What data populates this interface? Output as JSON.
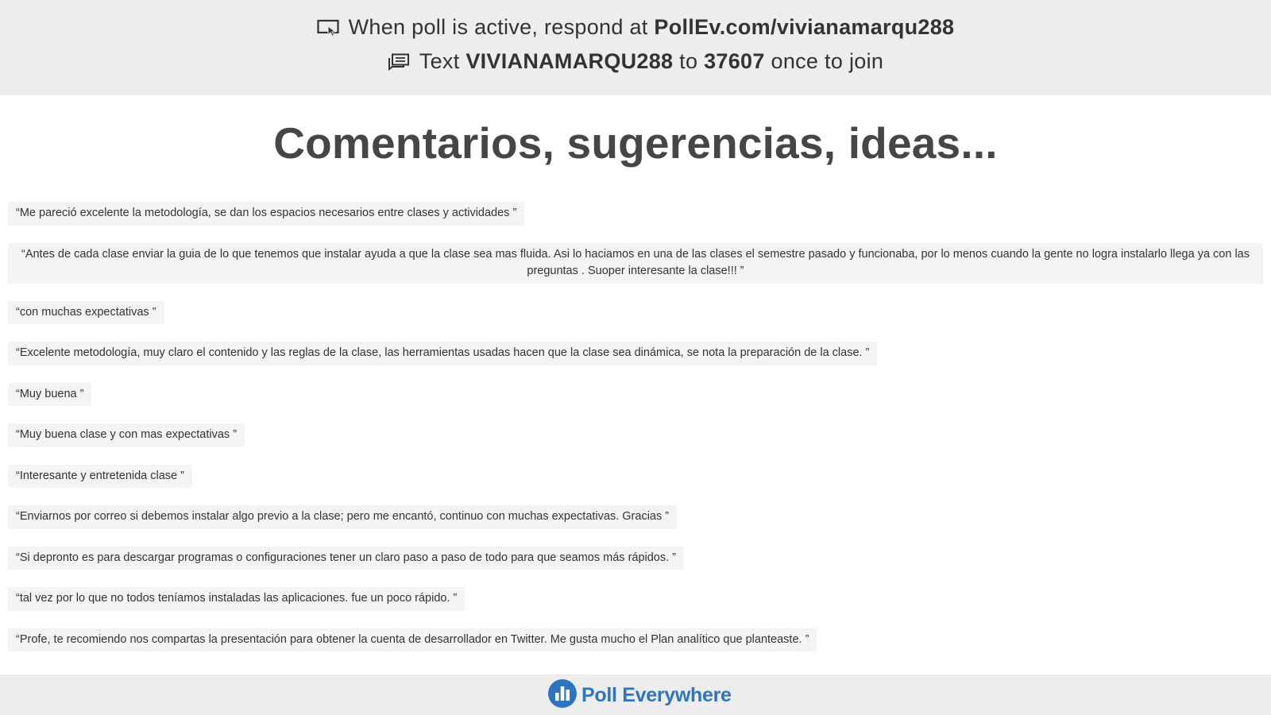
{
  "header": {
    "line1_icon": "presentation-screen-icon",
    "line1_prefix": "When poll is active, respond at ",
    "line1_url": "PollEv.com/vivianamarqu288",
    "line2_icon": "text-message-icon",
    "line2_prefix": "Text ",
    "line2_code": "VIVIANAMARQU288",
    "line2_mid": " to ",
    "line2_number": "37607",
    "line2_suffix": " once to join"
  },
  "poll": {
    "title": "Comentarios, sugerencias, ideas..."
  },
  "responses": [
    "“Me pareció excelente la metodología, se dan los espacios necesarios entre clases y actividades ”",
    "“Antes de cada clase enviar la guia de lo que tenemos que instalar ayuda a que la clase sea mas fluida. Asi lo haciamos en una de las clases el semestre pasado y funcionaba, por lo menos cuando la gente no logra instalarlo llega ya con las preguntas . Suoper interesante la clase!!! ”",
    "“con muchas expectativas ”",
    "“Excelente metodología, muy claro el contenido y las reglas de la clase, las herramientas usadas hacen que la clase sea dinámica, se nota la preparación de la clase. ”",
    "“Muy buena ”",
    "“Muy buena clase y con mas expectativas ”",
    "“Interesante y entretenida clase ”",
    "“Enviarnos por correo si debemos instalar algo previo a la clase; pero me encantó, continuo con muchas expectativas. Gracias ”",
    "“Si depronto es para descargar programas o configuraciones tener un claro paso a paso de todo para que seamos más rápidos. ”",
    "“tal vez por lo que no todos teníamos instaladas las aplicaciones. fue un poco rápido. ”",
    "“Profe, te recomiendo nos compartas la presentación para obtener la cuenta de desarrollador en Twitter. Me gusta mucho el Plan analítico que planteaste. ”"
  ],
  "footer": {
    "brand_icon": "poll-everywhere-logo-icon",
    "brand_name": "Poll Everywhere",
    "brand_color": "#2f74c0"
  }
}
